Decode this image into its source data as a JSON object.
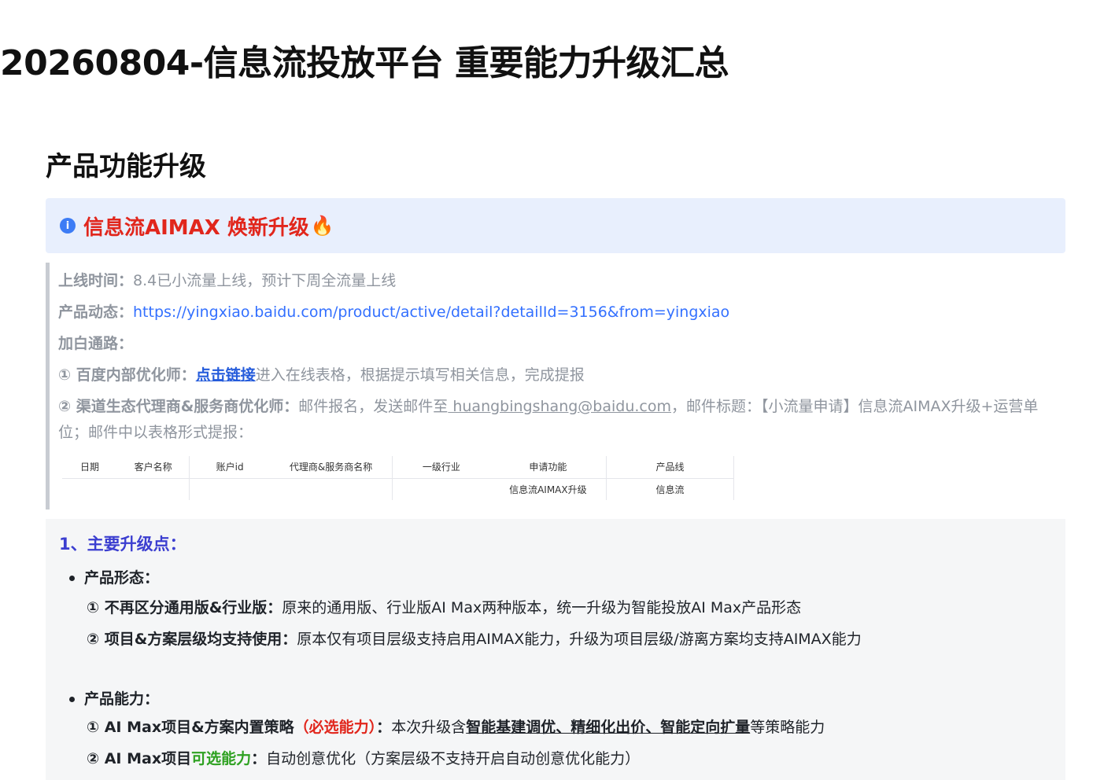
{
  "document": {
    "title": "20260804-信息流投放平台 重要能力升级汇总",
    "section_title": "产品功能升级"
  },
  "callout": {
    "icon": "info-icon",
    "title": "信息流AIMAX  焕新升级",
    "emoji": "🔥"
  },
  "quote": {
    "launch_label": "上线时间：",
    "launch_value": "8.4已小流量上线，预计下周全流量上线",
    "dynamic_label": "产品动态：",
    "dynamic_link": "https://yingxiao.baidu.com/product/active/detail?detailId=3156&from=yingxiao",
    "whitelist_label": "加白通路：",
    "path1_label": "① 百度内部优化师：",
    "path1_link": "点击链接",
    "path1_text": "进入在线表格，根据提示填写相关信息，完成提报",
    "path2_label": "② 渠道生态代理商&服务商优化师：",
    "path2_text1": "邮件报名，发送邮件至",
    "path2_email": " huangbingshang@baidu.com",
    "path2_text2": "，邮件标题：【小流量申请】信息流AIMAX升级+运营单",
    "path2_text3": "位；邮件中以表格形式提报："
  },
  "mini_table": {
    "headers": [
      "日期",
      "客户名称",
      "账户id",
      "代理商&服务商名称",
      "一级行业",
      "申请功能",
      "产品线"
    ],
    "row": [
      "",
      "",
      "",
      "",
      "",
      "信息流AIMAX升级",
      "信息流"
    ]
  },
  "panel": {
    "heading": "1、主要升级点：",
    "form_title": "产品形态：",
    "form_item1_bold": "① 不再区分通用版&行业版：",
    "form_item1_text": "原来的通用版、行业版AI Max两种版本，统一升级为智能投放AI Max产品形态",
    "form_item2_bold": "② 项目&方案层级均支持使用：",
    "form_item2_text": "原本仅有项目层级支持启用AIMAX能力，升级为项目层级/游离方案均支持AIMAX能力",
    "ability_title": "产品能力：",
    "ability_item1_bold": "① AI Max项目&方案内置策略",
    "ability_item1_red": "（必选能力）",
    "ability_item1_colon": "：",
    "ability_item1_text": "本次升级含",
    "ability_item1_ul": "智能基建调优、精细化出价、智能定向扩量",
    "ability_item1_tail": "等策略能力",
    "ability_item2_bold": "② AI Max项目",
    "ability_item2_green": "可选能力",
    "ability_item2_colon": "：",
    "ability_item2_text": "自动创意优化（方案层级不支持开启自动创意优化能力）"
  },
  "colors": {
    "callout_bg": "#e8effd",
    "accent_red": "#e1261c",
    "accent_green": "#2ea121",
    "link_blue": "#3370ff",
    "heading_purple": "#3b3ed0"
  }
}
